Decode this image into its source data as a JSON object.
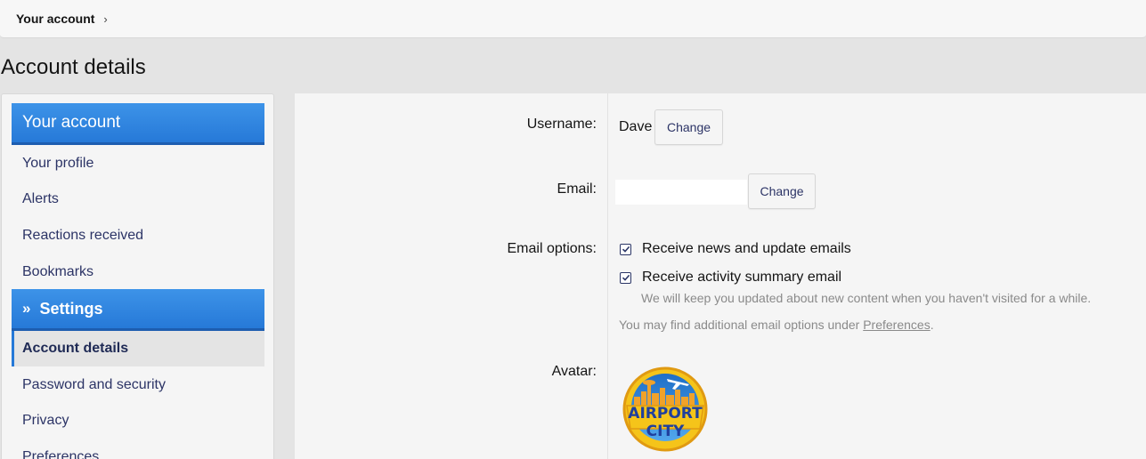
{
  "breadcrumb": {
    "label": "Your account",
    "chevron": "›"
  },
  "page_title": "Account details",
  "sidebar": {
    "section1": {
      "label": "Your account"
    },
    "items1": [
      {
        "label": "Your profile"
      },
      {
        "label": "Alerts"
      },
      {
        "label": "Reactions received"
      },
      {
        "label": "Bookmarks"
      }
    ],
    "section2": {
      "icon": "»",
      "label": "Settings"
    },
    "items2": [
      {
        "label": "Account details",
        "active": true
      },
      {
        "label": "Password and security"
      },
      {
        "label": "Privacy"
      },
      {
        "label": "Preferences"
      }
    ]
  },
  "form": {
    "username": {
      "label": "Username:",
      "value": "Dave",
      "button": "Change"
    },
    "email": {
      "label": "Email:",
      "button": "Change"
    },
    "email_options": {
      "label": "Email options:",
      "options": [
        {
          "label": "Receive news and update emails",
          "checked": true
        },
        {
          "label": "Receive activity summary email",
          "checked": true,
          "hint": "We will keep you updated about new content when you haven't visited for a while."
        }
      ],
      "footer_prefix": "You may find additional email options under ",
      "footer_link": "Preferences",
      "footer_suffix": "."
    },
    "avatar": {
      "label": "Avatar:",
      "text_line1": "AIRPORT",
      "text_line2": "CITY"
    }
  },
  "colors": {
    "accent": "#2679d8",
    "link": "#2c3466",
    "background": "#e4e4e4",
    "panel": "#f5f5f5"
  }
}
